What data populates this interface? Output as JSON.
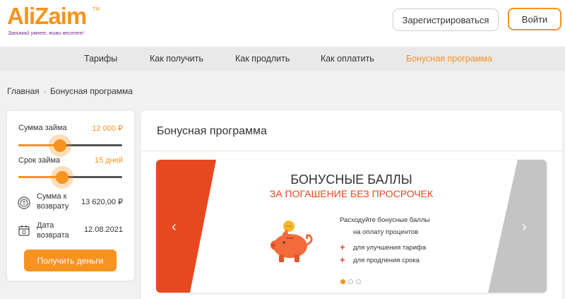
{
  "header": {
    "logo_text": "AliZaim",
    "logo_tm": "TM",
    "tagline": "Занимай умнее, живи веселее!",
    "register_label": "Зарегистрироваться",
    "login_label": "Войти"
  },
  "nav": {
    "items": [
      {
        "label": "Тарифы"
      },
      {
        "label": "Как получить"
      },
      {
        "label": "Как продлить"
      },
      {
        "label": "Как оплатить"
      },
      {
        "label": "Бонусная программа"
      }
    ],
    "active_index": 4
  },
  "breadcrumb": {
    "home": "Главная",
    "separator": "›",
    "current": "Бонусная программа"
  },
  "calculator": {
    "amount_label": "Сумма займа",
    "amount_value": "12 000 ₽",
    "amount_fraction": 0.4,
    "term_label": "Срок займа",
    "term_value": "15 дней",
    "term_fraction": 0.42,
    "return_sum_label": "Сумма к возврату",
    "return_sum_value": "13 620,00 ₽",
    "return_date_label": "Дата возврата",
    "return_date_value": "12.08.2021",
    "submit_label": "Получить деньги"
  },
  "main": {
    "title": "Бонусная программа"
  },
  "banner": {
    "heading": "БОНУСНЫЕ БАЛЛЫ",
    "subheading": "ЗА ПОГАШЕНИЕ БЕЗ ПРОСРОЧЕК",
    "line1": "Расходуйте бонусные баллы",
    "line2": "на оплату процентов",
    "bullet1": "для улучшения тарифа",
    "bullet2": "для продления срока",
    "prev_arrow": "‹",
    "next_arrow": "›",
    "slide_count": 3,
    "active_slide": 0
  },
  "colors": {
    "accent": "#f7931e",
    "red": "#e8481f",
    "gray_stripe": "#c4c4c4"
  }
}
